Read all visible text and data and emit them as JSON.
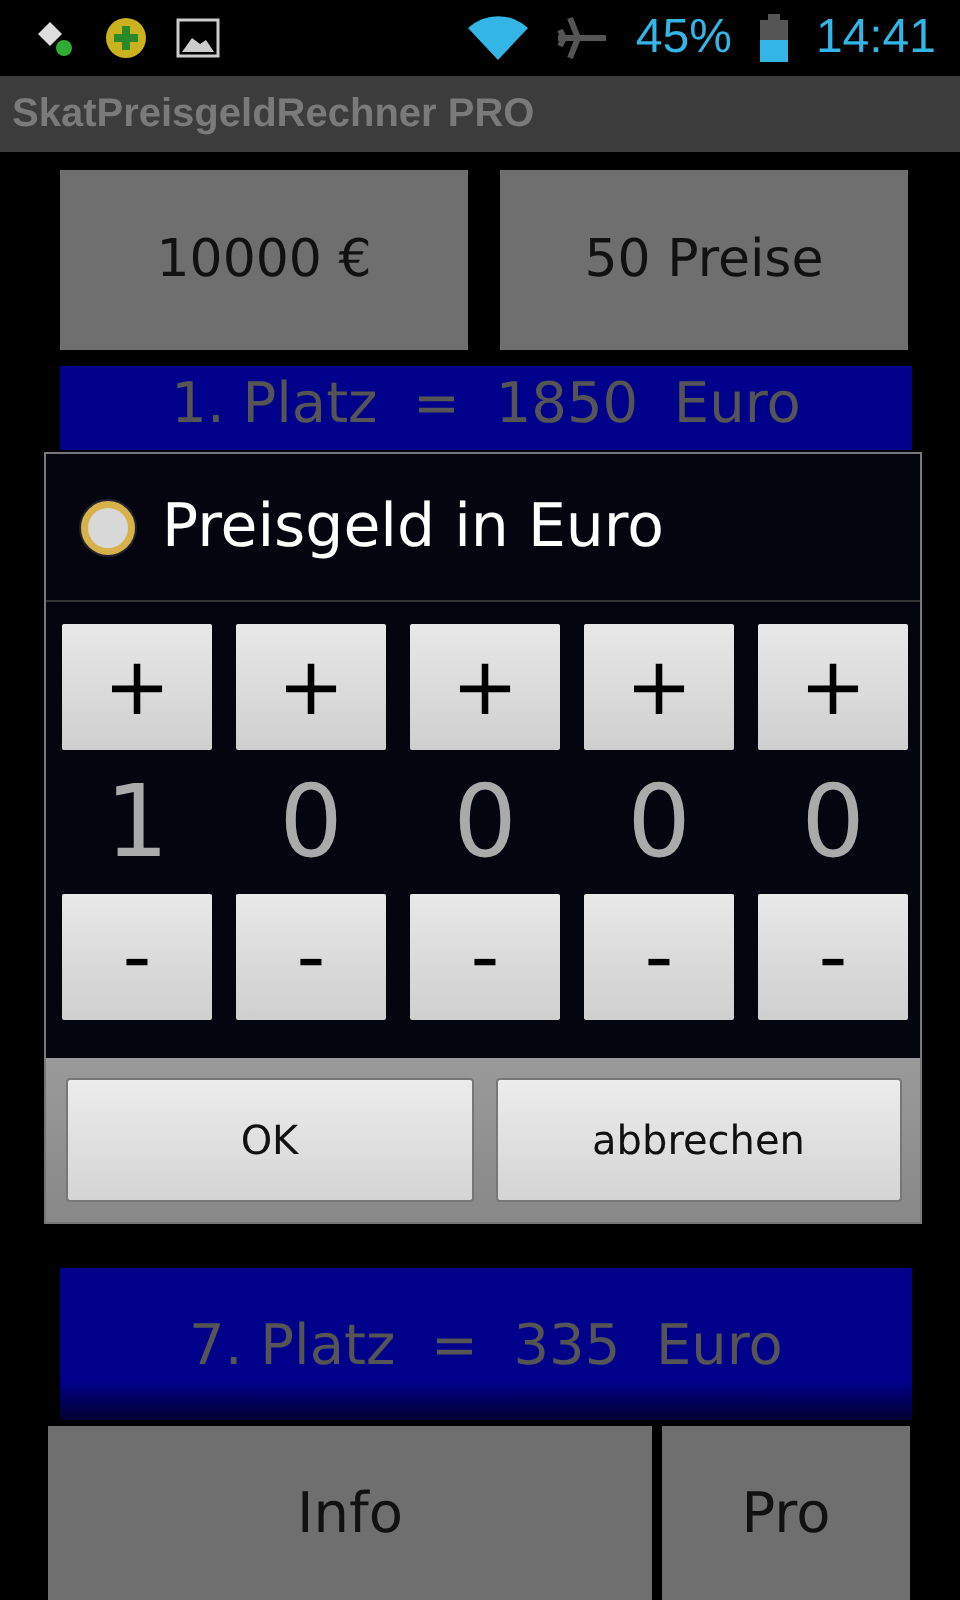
{
  "status_bar": {
    "battery": "45%",
    "time": "14:41"
  },
  "app_title": "SkatPreisgeldRechner PRO",
  "top_buttons": [
    "10000 €",
    "50 Preise"
  ],
  "prize_list": [
    "1. Platz  =  1850  Euro",
    "7. Platz  =  335  Euro"
  ],
  "bottom_buttons": [
    "Info",
    "Pro"
  ],
  "dialog": {
    "title": "Preisgeld in Euro",
    "digits": [
      {
        "plus": "+",
        "value": "1",
        "minus": "-"
      },
      {
        "plus": "+",
        "value": "0",
        "minus": "-"
      },
      {
        "plus": "+",
        "value": "0",
        "minus": "-"
      },
      {
        "plus": "+",
        "value": "0",
        "minus": "-"
      },
      {
        "plus": "+",
        "value": "0",
        "minus": "-"
      }
    ],
    "buttons": [
      "OK",
      "abbrechen"
    ]
  }
}
